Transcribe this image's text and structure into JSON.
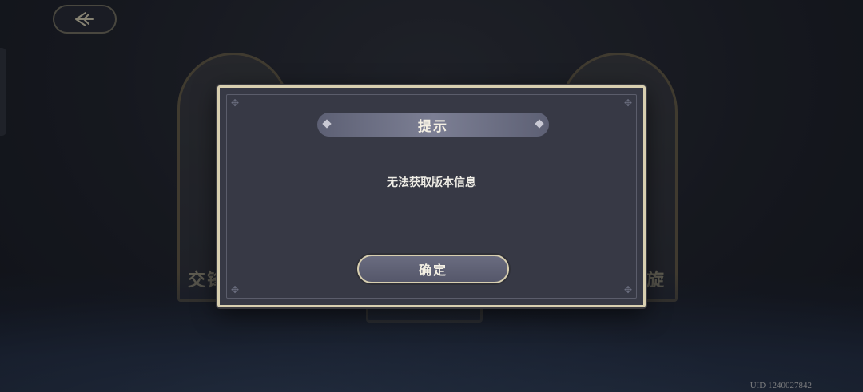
{
  "background": {
    "card_left_text": "交锋",
    "card_right_text": "旋"
  },
  "dialog": {
    "title": "提示",
    "message": "无法获取版本信息",
    "confirm_label": "确定"
  },
  "footer": {
    "uid": "UID 1240027842"
  },
  "colors": {
    "dialog_bg": "#373945",
    "dialog_border": "#d8cfb0",
    "title_bar": "#7c7f94",
    "button_bg": "#5f6175"
  },
  "icons": {
    "back": "back-arrow-icon"
  }
}
